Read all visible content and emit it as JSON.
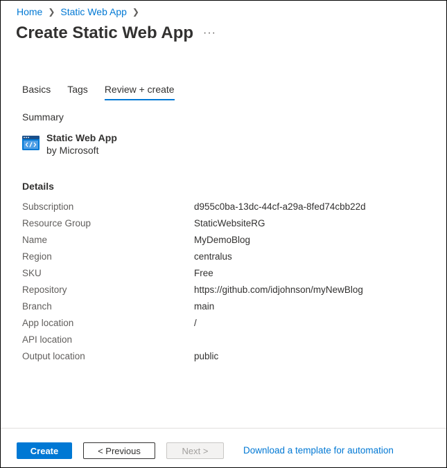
{
  "breadcrumb": {
    "items": [
      "Home",
      "Static Web App"
    ]
  },
  "page": {
    "title": "Create Static Web App",
    "more_label": "···"
  },
  "tabs": [
    {
      "label": "Basics",
      "active": false
    },
    {
      "label": "Tags",
      "active": false
    },
    {
      "label": "Review + create",
      "active": true
    }
  ],
  "summary": {
    "heading": "Summary",
    "product_name": "Static Web App",
    "publisher": "by Microsoft",
    "icon": "static-web-app-icon"
  },
  "details": {
    "heading": "Details",
    "rows": [
      {
        "label": "Subscription",
        "value": "d955c0ba-13dc-44cf-a29a-8fed74cbb22d"
      },
      {
        "label": "Resource Group",
        "value": "StaticWebsiteRG"
      },
      {
        "label": "Name",
        "value": "MyDemoBlog"
      },
      {
        "label": "Region",
        "value": "centralus"
      },
      {
        "label": "SKU",
        "value": "Free"
      },
      {
        "label": "Repository",
        "value": "https://github.com/idjohnson/myNewBlog"
      },
      {
        "label": "Branch",
        "value": "main"
      },
      {
        "label": "App location",
        "value": "/"
      },
      {
        "label": "API location",
        "value": ""
      },
      {
        "label": "Output location",
        "value": "public"
      }
    ]
  },
  "footer": {
    "create_label": "Create",
    "previous_label": "< Previous",
    "next_label": "Next >",
    "download_label": "Download a template for automation"
  },
  "colors": {
    "accent": "#0078d4",
    "text": "#323130",
    "muted_text": "#605e5c"
  }
}
